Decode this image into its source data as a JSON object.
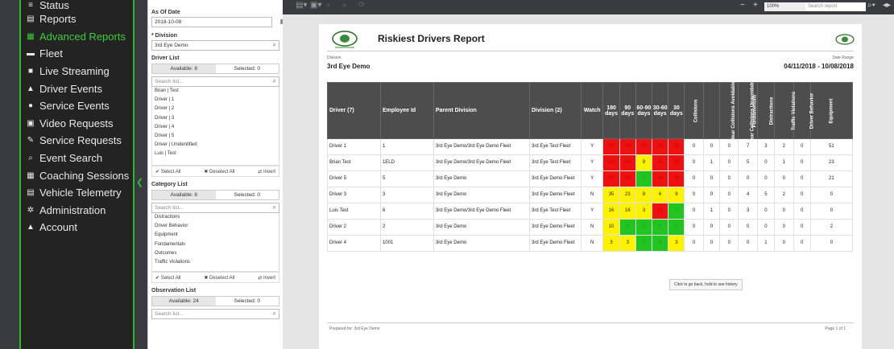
{
  "nav": [
    {
      "label": "Status",
      "icon": "menu-icon"
    },
    {
      "label": "Reports",
      "icon": "document-icon"
    },
    {
      "label": "Advanced Reports",
      "icon": "chart-icon",
      "active": true
    },
    {
      "label": "Fleet",
      "icon": "truck-icon"
    },
    {
      "label": "Live Streaming",
      "icon": "video-camera-icon"
    },
    {
      "label": "Driver Events",
      "icon": "warning-icon"
    },
    {
      "label": "Service Events",
      "icon": "info-icon"
    },
    {
      "label": "Video Requests",
      "icon": "video-request-icon"
    },
    {
      "label": "Service Requests",
      "icon": "wrench-icon"
    },
    {
      "label": "Event Search",
      "icon": "search-icon"
    },
    {
      "label": "Coaching Sessions",
      "icon": "calendar-icon"
    },
    {
      "label": "Vehicle Telemetry",
      "icon": "telemetry-icon"
    },
    {
      "label": "Administration",
      "icon": "gear-icon"
    },
    {
      "label": "Account",
      "icon": "user-icon"
    }
  ],
  "filters": {
    "as_of_label": "As Of Date",
    "as_of_value": "2018-10-08",
    "division_label": "* Division",
    "division_value": "3rd Eye Demo",
    "driver_list_label": "Driver List",
    "driver_available": "Available: 8",
    "driver_selected": "Selected: 0",
    "search_placeholder": "Search list...",
    "drivers": [
      "Brian | Test",
      "Driver | 1",
      "Driver | 2",
      "Driver | 3",
      "Driver | 4",
      "Driver | 5",
      "Driver | Unidentified",
      "Luis | Test"
    ],
    "select_all": "✔ Select All",
    "deselect_all": "✖ Deselect All",
    "invert": "⇄ Invert",
    "category_label": "Category List",
    "category_available": "Available: 6",
    "category_selected": "Selected: 0",
    "categories": [
      "Distractions",
      "Driver Behavior",
      "Equipment",
      "Fundamentals",
      "Outcomes",
      "Traffic Violations"
    ],
    "observation_label": "Observation List",
    "observation_available": "Available: 24",
    "observation_selected": "Selected: 0"
  },
  "toolbar": {
    "zoom": "100%",
    "search_placeholder": "Search report"
  },
  "report": {
    "title": "Riskiest Drivers Report",
    "division_caption": "Division",
    "division": "3rd Eye Demo",
    "date_range_caption": "Date Range",
    "date_range": "04/11/2018 - 10/08/2018",
    "columns": [
      "Driver (7)",
      "Employee Id",
      "Parent Division",
      "Division (2)",
      "Watch",
      "180 days",
      "90 days",
      "60-90 days",
      "30-60 days",
      "30 days",
      "Collisions",
      "Near Collisions Avoidable",
      "Near Collisions Unavoidable",
      "Fundamentals",
      "Distractions",
      "Traffic Violations",
      "Driver Behavior",
      "Equipment"
    ],
    "rows": [
      {
        "driver": "Driver 1",
        "emp": "1",
        "parent": "3rd Eye Demo/3rd Eye Demo Fleet",
        "division": "3rd Eye Test Fleet",
        "watch": "Y",
        "scores": [
          "200",
          "180",
          "45",
          "25",
          "28"
        ],
        "colors": [
          "red",
          "red",
          "red",
          "red",
          "red"
        ],
        "counts": [
          "0",
          "0",
          "0",
          "7",
          "3",
          "2",
          "0",
          "51"
        ]
      },
      {
        "driver": "Brian Test",
        "emp": "1ELD",
        "parent": "3rd Eye Demo/3rd Eye Demo Fleet",
        "division": "3rd Eye Test Fleet",
        "watch": "Y",
        "scores": [
          "120",
          "105",
          "9",
          "75",
          "30"
        ],
        "colors": [
          "red",
          "red",
          "yel",
          "red",
          "red"
        ],
        "counts": [
          "0",
          "1",
          "0",
          "5",
          "0",
          "1",
          "0",
          "23"
        ]
      },
      {
        "driver": "Driver 5",
        "emp": "5",
        "parent": "3rd Eye Demo",
        "division": "3rd Eye Demo Fleet",
        "watch": "Y",
        "scores": [
          "100",
          "100",
          "0",
          "45",
          "38"
        ],
        "colors": [
          "red",
          "red",
          "grn",
          "red",
          "red"
        ],
        "counts": [
          "0",
          "0",
          "0",
          "0",
          "0",
          "0",
          "0",
          "21"
        ]
      },
      {
        "driver": "Driver 3",
        "emp": "3",
        "parent": "3rd Eye Demo",
        "division": "3rd Eye Demo Fleet",
        "watch": "N",
        "scores": [
          "35",
          "23",
          "8",
          "6",
          "9"
        ],
        "colors": [
          "yel",
          "yel",
          "yel",
          "yel",
          "yel"
        ],
        "counts": [
          "0",
          "0",
          "0",
          "4",
          "5",
          "2",
          "0",
          "0"
        ]
      },
      {
        "driver": "Luis Test",
        "emp": "6",
        "parent": "3rd Eye Demo/3rd Eye Demo Fleet",
        "division": "3rd Eye Test Fleet",
        "watch": "Y",
        "scores": [
          "16",
          "16",
          "3",
          "13",
          "0"
        ],
        "colors": [
          "yel",
          "yel",
          "yel",
          "red",
          "grn"
        ],
        "counts": [
          "0",
          "1",
          "0",
          "3",
          "0",
          "0",
          "0",
          "0"
        ]
      },
      {
        "driver": "Driver 2",
        "emp": "2",
        "parent": "3rd Eye Demo",
        "division": "3rd Eye Demo Fleet",
        "watch": "N",
        "scores": [
          "10",
          "0",
          "0",
          "0",
          "0"
        ],
        "colors": [
          "yel",
          "grn",
          "grn",
          "grn",
          "grn"
        ],
        "counts": [
          "0",
          "0",
          "0",
          "0",
          "0",
          "0",
          "0",
          "2"
        ]
      },
      {
        "driver": "Driver 4",
        "emp": "1001",
        "parent": "3rd Eye Demo",
        "division": "3rd Eye Demo Fleet",
        "watch": "N",
        "scores": [
          "3",
          "3",
          "0",
          "0",
          "3"
        ],
        "colors": [
          "yel",
          "yel",
          "grn",
          "grn",
          "yel"
        ],
        "counts": [
          "0",
          "0",
          "0",
          "0",
          "1",
          "0",
          "0",
          "0"
        ]
      }
    ],
    "tooltip": "Click to go back, hold to see history",
    "prepared": "Prepared for: 3rd Eye Demo",
    "page": "Page 1 of 1"
  }
}
